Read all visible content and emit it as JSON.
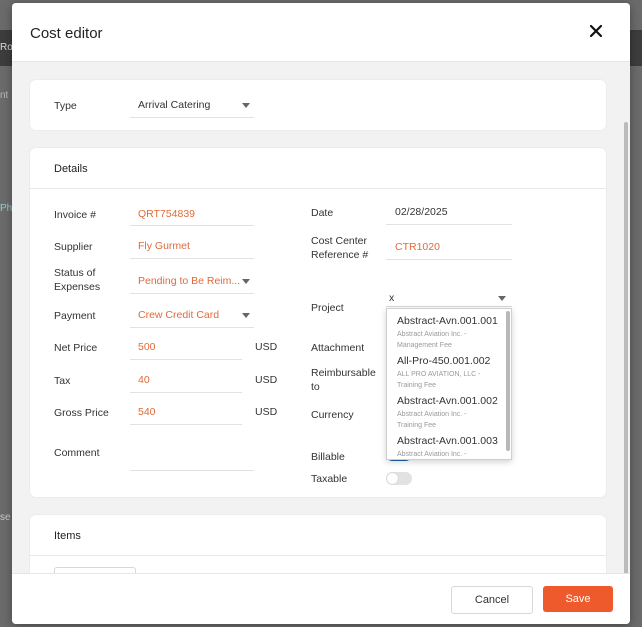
{
  "dialog": {
    "title": "Cost editor",
    "type_label": "Type",
    "type_value": "Arrival Catering"
  },
  "background": {
    "text_1": "Ro",
    "text_2": "nt",
    "text_3": "Ph",
    "text_4": "se"
  },
  "details": {
    "section_title": "Details",
    "invoice": {
      "label": "Invoice #",
      "value": "QRT754839"
    },
    "supplier": {
      "label": "Supplier",
      "value": "Fly Gurmet"
    },
    "status": {
      "label": "Status of Expenses",
      "value": "Pending to Be Reim..."
    },
    "payment": {
      "label": "Payment",
      "value": "Crew Credit Card"
    },
    "net_price": {
      "label": "Net Price",
      "value": "500",
      "currency": "USD"
    },
    "tax": {
      "label": "Tax",
      "value": "40",
      "currency": "USD"
    },
    "gross_price": {
      "label": "Gross Price",
      "value": "540",
      "currency": "USD"
    },
    "comment": {
      "label": "Comment",
      "value": ""
    },
    "date": {
      "label": "Date",
      "value": "02/28/2025"
    },
    "cost_center": {
      "label": "Cost Center Reference #",
      "value": "CTR1020"
    },
    "project": {
      "label": "Project",
      "value": "x"
    },
    "attachment": {
      "label": "Attachment"
    },
    "reimbursable": {
      "label": "Reimbursable to"
    },
    "currency": {
      "label": "Currency"
    },
    "billable": {
      "label": "Billable",
      "on": true
    },
    "taxable": {
      "label": "Taxable",
      "on": false
    }
  },
  "project_dropdown": {
    "options": [
      {
        "code": "Abstract-Avn.001.001",
        "company": "Abstract Aviation Inc. -",
        "desc": "Management Fee"
      },
      {
        "code": "All-Pro-450.001.002",
        "company": "ALL PRO AVIATION, LLC -",
        "desc": "Training Fee"
      },
      {
        "code": "Abstract-Avn.001.002",
        "company": "Abstract Aviation Inc. -",
        "desc": "Training Fee"
      },
      {
        "code": "Abstract-Avn.001.003",
        "company": "Abstract Aviation Inc. -",
        "desc": ""
      }
    ]
  },
  "items": {
    "section_title": "Items"
  },
  "footer": {
    "cancel_label": "Cancel",
    "save_label": "Save"
  },
  "colors": {
    "accent": "#ef5a2c",
    "value_text": "#e06a3a",
    "toggle_on": "#1f5fa8"
  }
}
